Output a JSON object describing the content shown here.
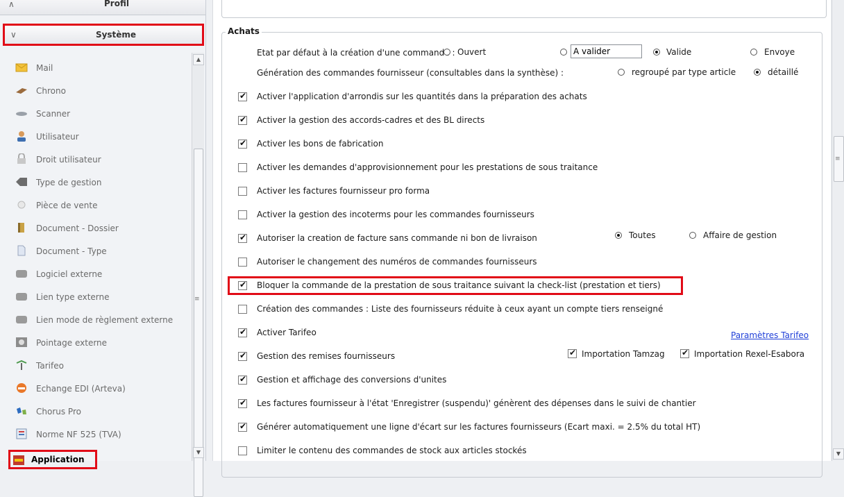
{
  "sidebar": {
    "profil_label": "Profil",
    "systeme_label": "Système",
    "items": [
      {
        "label": "Mail",
        "icon": "mail-icon"
      },
      {
        "label": "Chrono",
        "icon": "chrono-icon"
      },
      {
        "label": "Scanner",
        "icon": "scanner-icon"
      },
      {
        "label": "Utilisateur",
        "icon": "user-icon"
      },
      {
        "label": "Droit utilisateur",
        "icon": "lock-icon"
      },
      {
        "label": "Type de gestion",
        "icon": "tag-icon"
      },
      {
        "label": "Pièce de vente",
        "icon": "coin-icon"
      },
      {
        "label": "Document - Dossier",
        "icon": "folder-icon"
      },
      {
        "label": "Document - Type",
        "icon": "document-icon"
      },
      {
        "label": "Logiciel externe",
        "icon": "external-app-icon"
      },
      {
        "label": "Lien type externe",
        "icon": "external-link-icon"
      },
      {
        "label": "Lien mode de règlement externe",
        "icon": "payment-link-icon"
      },
      {
        "label": "Pointage externe",
        "icon": "clock-in-icon"
      },
      {
        "label": "Tarifeo",
        "icon": "tarifeo-icon"
      },
      {
        "label": "Echange EDI (Arteva)",
        "icon": "edi-icon"
      },
      {
        "label": "Chorus Pro",
        "icon": "chorus-icon"
      },
      {
        "label": "Norme NF 525 (TVA)",
        "icon": "nf525-icon"
      },
      {
        "label": "Application",
        "icon": "application-icon"
      }
    ]
  },
  "achats": {
    "legend": "Achats",
    "etat_label": "Etat par défaut à la création d'une commande :",
    "etat_options": [
      "Ouvert",
      "A valider",
      "Valide",
      "Envoye"
    ],
    "etat_selected": "Valide",
    "avalider_value": "A valider",
    "generation_label": "Génération des commandes fournisseur (consultables dans la synthèse) :",
    "generation_options": [
      "regroupé par type article",
      "détaillé"
    ],
    "generation_selected": "détaillé",
    "rows": [
      {
        "label": "Activer l'application d'arrondis sur les quantités dans la préparation des achats",
        "checked": true
      },
      {
        "label": "Activer la gestion des accords-cadres et des BL directs",
        "checked": true
      },
      {
        "label": "Activer les bons de fabrication",
        "checked": true
      },
      {
        "label": "Activer les demandes d'approvisionnement pour les prestations de sous traitance",
        "checked": false
      },
      {
        "label": "Activer les factures fournisseur pro forma",
        "checked": false
      },
      {
        "label": "Activer la gestion des incoterms pour les commandes fournisseurs",
        "checked": false
      },
      {
        "label": "Autoriser la creation de facture sans commande ni bon de livraison",
        "checked": true
      },
      {
        "label": "Autoriser le changement des numéros de commandes fournisseurs",
        "checked": false
      },
      {
        "label": "Bloquer la commande de la prestation de sous traitance suivant la check-list (prestation et tiers)",
        "checked": true
      },
      {
        "label": "Création des commandes : Liste des fournisseurs réduite à ceux ayant un compte tiers renseigné",
        "checked": false
      },
      {
        "label": "Activer Tarifeo",
        "checked": true
      },
      {
        "label": "Gestion des remises fournisseurs",
        "checked": true
      },
      {
        "label": "Gestion et affichage des conversions d'unites",
        "checked": true
      },
      {
        "label": "Les factures fournisseur à l'état 'Enregistrer (suspendu)' génèrent des dépenses dans le suivi de chantier",
        "checked": true
      },
      {
        "label": "Générer automatiquement une ligne d'écart sur les factures fournisseurs (Ecart maxi. = 2.5% du total HT)",
        "checked": true
      },
      {
        "label": "Limiter le contenu des commandes de stock aux articles stockés",
        "checked": false
      }
    ],
    "facture_options": [
      "Toutes",
      "Affaire de gestion"
    ],
    "facture_selected": "Toutes",
    "tarifeo_link": "Paramètres Tarifeo",
    "import_tamzag": "Importation Tamzag",
    "import_rexel": "Importation Rexel-Esabora"
  },
  "colors": {
    "highlight": "#e10b17",
    "link": "#1f3fd8"
  }
}
